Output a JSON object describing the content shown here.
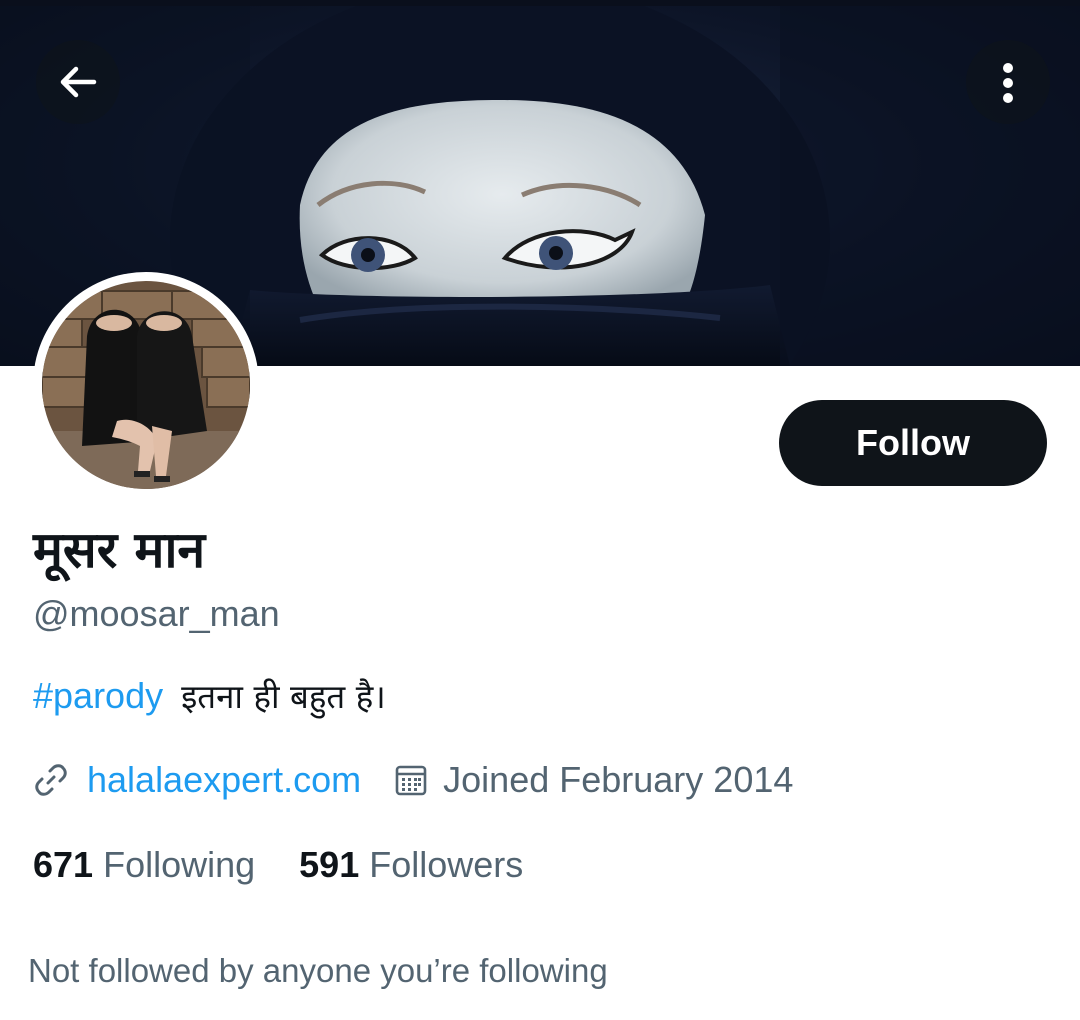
{
  "header": {
    "back_icon": "arrow-left-icon",
    "more_icon": "more-vertical-icon"
  },
  "profile": {
    "display_name": "मूसर मान",
    "handle": "@moosar_man",
    "follow_label": "Follow",
    "bio_hashtag": "#parody",
    "bio_text": "इतना ही बहुत है।",
    "website": "halalaexpert.com",
    "joined": "Joined February 2014",
    "following_count": "671",
    "following_label": "Following",
    "followers_count": "591",
    "followers_label": "Followers",
    "not_followed_text": "Not followed by anyone you’re following"
  },
  "colors": {
    "accent": "#1d9bf0",
    "text_primary": "#0f1419",
    "text_secondary": "#536471"
  }
}
